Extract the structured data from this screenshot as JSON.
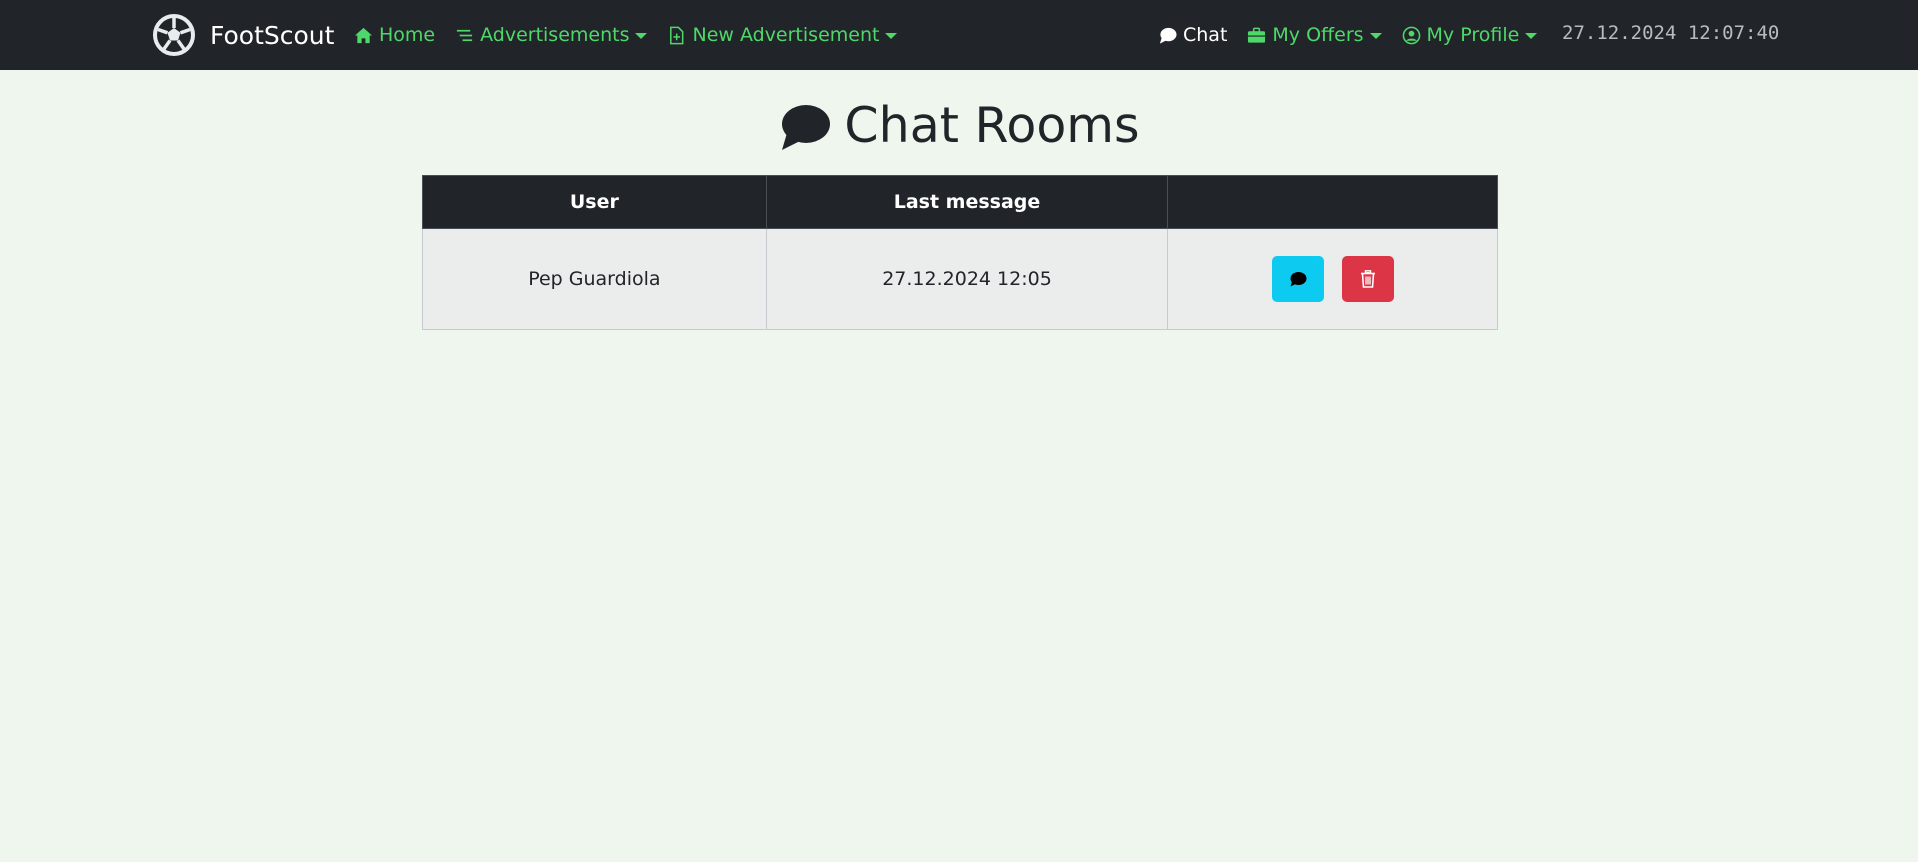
{
  "brand": {
    "name": "FootScout"
  },
  "nav": {
    "left": [
      {
        "label": "Home",
        "icon": "house-icon",
        "dropdown": false
      },
      {
        "label": "Advertisements",
        "icon": "list-lines-icon",
        "dropdown": true
      },
      {
        "label": "New Advertisement",
        "icon": "file-plus-icon",
        "dropdown": true
      }
    ],
    "right": [
      {
        "label": "Chat",
        "icon": "chat-bubble-icon",
        "dropdown": false,
        "active": true
      },
      {
        "label": "My Offers",
        "icon": "briefcase-icon",
        "dropdown": true
      },
      {
        "label": "My Profile",
        "icon": "person-circle-icon",
        "dropdown": true
      }
    ],
    "clock": "27.12.2024 12:07:40"
  },
  "page": {
    "title": "Chat Rooms",
    "title_icon": "chat-bubble-icon"
  },
  "table": {
    "headers": [
      "User",
      "Last message",
      ""
    ],
    "rows": [
      {
        "user": "Pep Guardiola",
        "last_message": "27.12.2024 12:05",
        "actions": [
          "open-chat",
          "delete"
        ]
      }
    ]
  },
  "colors": {
    "navbar": "#212529",
    "nav_link": "#4fd86a",
    "background": "#eff6ee",
    "chat_button": "#0dcaf0",
    "delete_button": "#dc3545"
  }
}
